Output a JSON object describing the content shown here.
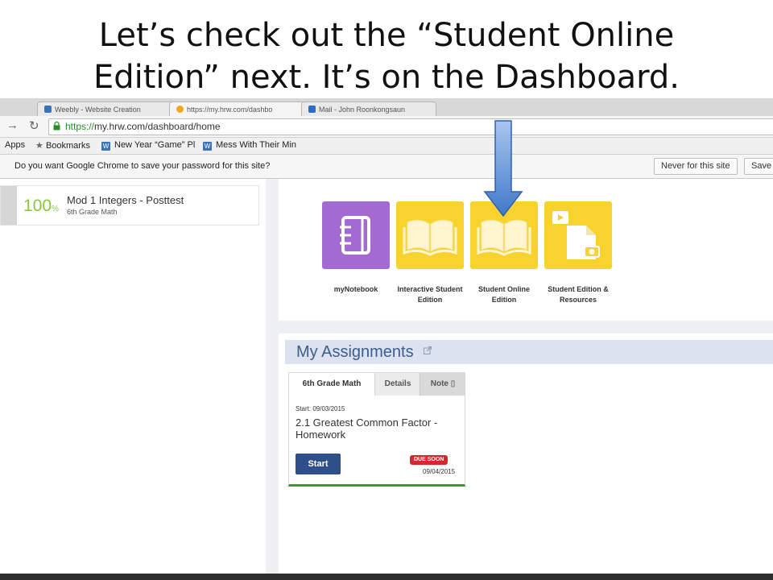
{
  "slide": {
    "title_line1": "Let’s check out the “Student Online",
    "title_line2": "Edition” next. It’s on the Dashboard."
  },
  "browser": {
    "tabs": [
      "Weebly - Website Creation",
      "https://my.hrw.com/dashbo",
      "Mail - John Roonkongsaun"
    ],
    "url_scheme": "https://",
    "url_rest": "my.hrw.com/dashboard/home",
    "bookmarks": {
      "apps": "Apps",
      "bookmarks": "Bookmarks",
      "item1": "New Year “Game” Pl",
      "item2": "Mess With Their Min"
    },
    "infobar": {
      "message": "Do you want Google Chrome to save your password for this site?",
      "never": "Never for this site",
      "save": "Save"
    }
  },
  "result": {
    "percent": "100",
    "percent_sign": "%",
    "title": "Mod 1 Integers - Posttest",
    "subtitle": "6th Grade Math"
  },
  "apps": {
    "items": [
      {
        "label_line1": "myNotebook",
        "label_line2": ""
      },
      {
        "label_line1": "Interactive Student",
        "label_line2": "Edition"
      },
      {
        "label_line1": "Student Online",
        "label_line2": "Edition"
      },
      {
        "label_line1": "Student Edition &",
        "label_line2": "Resources"
      }
    ]
  },
  "assignments": {
    "title": "My Assignments",
    "tabs": [
      "6th Grade Math",
      "Details",
      "Note"
    ],
    "start": "Start: 09/03/2015",
    "name": "2.1 Greatest Common Factor - Homework",
    "start_button": "Start",
    "due_badge": "DUE SOON",
    "due_date": "09/04/2015"
  },
  "colors": {
    "purple_tile": "#a36bd1",
    "yellow_tile": "#f8d32e",
    "accent_blue": "#2f4f8a",
    "due_red": "#d8262f",
    "score_green": "#8cc63e"
  }
}
